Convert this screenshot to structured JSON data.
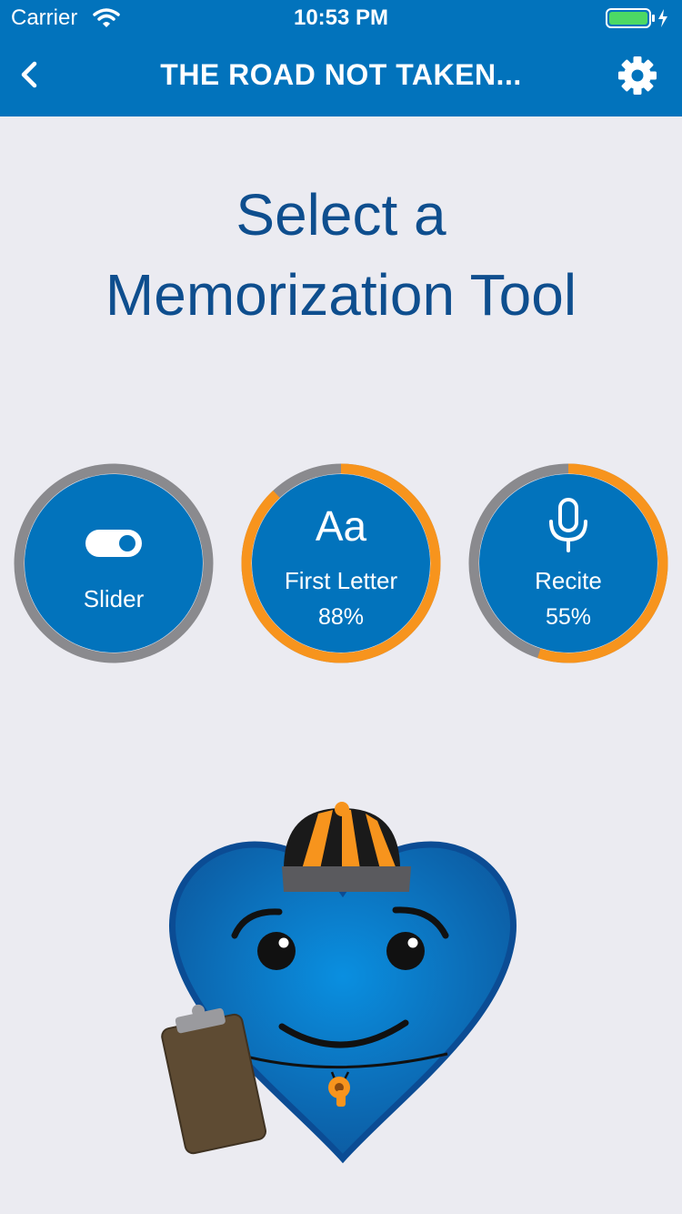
{
  "status_bar": {
    "carrier": "Carrier",
    "time": "10:53 PM",
    "icons": [
      "wifi-icon",
      "battery-icon",
      "charging-bolt-icon"
    ]
  },
  "nav": {
    "title": "THE ROAD NOT TAKEN...",
    "back_icon": "chevron-left-icon",
    "settings_icon": "gear-icon"
  },
  "heading": {
    "line1": "Select a",
    "line2": "Memorization Tool"
  },
  "tools": [
    {
      "label": "Slider",
      "icon": "toggle-switch-icon",
      "progress": 0
    },
    {
      "label": "First Letter",
      "icon_text": "Aa",
      "percent": "88%",
      "progress": 0.88
    },
    {
      "label": "Recite",
      "icon": "microphone-icon",
      "percent": "55%",
      "progress": 0.55
    }
  ],
  "colors": {
    "header": "#0273BC",
    "background": "#EBEBF1",
    "heading": "#0E4E8E",
    "button": "#0273BC",
    "ring_track": "#8A8A8E",
    "ring_progress": "#F7941D"
  },
  "mascot": {
    "icon": "heart-coach-mascot-icon"
  }
}
